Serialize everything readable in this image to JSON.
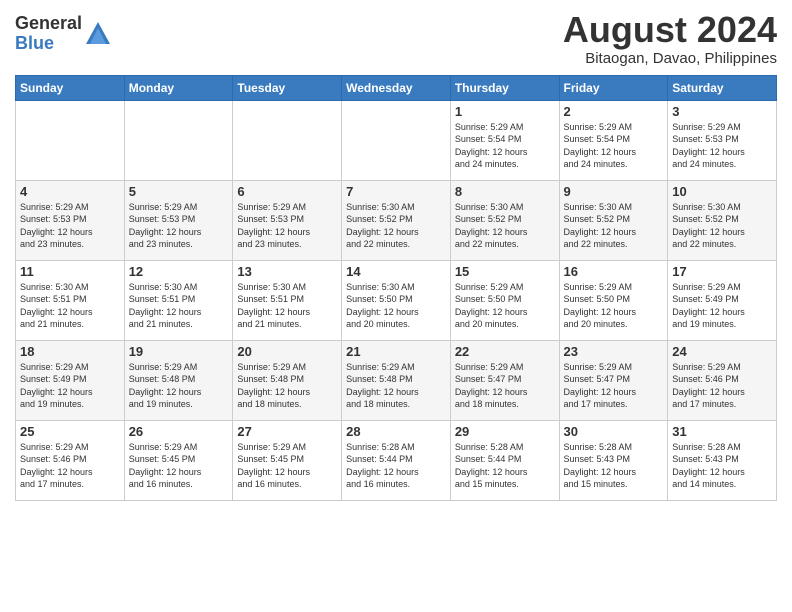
{
  "logo": {
    "general": "General",
    "blue": "Blue"
  },
  "title": {
    "month_year": "August 2024",
    "location": "Bitaogan, Davao, Philippines"
  },
  "days_of_week": [
    "Sunday",
    "Monday",
    "Tuesday",
    "Wednesday",
    "Thursday",
    "Friday",
    "Saturday"
  ],
  "weeks": [
    [
      {
        "day": "",
        "info": ""
      },
      {
        "day": "",
        "info": ""
      },
      {
        "day": "",
        "info": ""
      },
      {
        "day": "",
        "info": ""
      },
      {
        "day": "1",
        "info": "Sunrise: 5:29 AM\nSunset: 5:54 PM\nDaylight: 12 hours\nand 24 minutes."
      },
      {
        "day": "2",
        "info": "Sunrise: 5:29 AM\nSunset: 5:54 PM\nDaylight: 12 hours\nand 24 minutes."
      },
      {
        "day": "3",
        "info": "Sunrise: 5:29 AM\nSunset: 5:53 PM\nDaylight: 12 hours\nand 24 minutes."
      }
    ],
    [
      {
        "day": "4",
        "info": "Sunrise: 5:29 AM\nSunset: 5:53 PM\nDaylight: 12 hours\nand 23 minutes."
      },
      {
        "day": "5",
        "info": "Sunrise: 5:29 AM\nSunset: 5:53 PM\nDaylight: 12 hours\nand 23 minutes."
      },
      {
        "day": "6",
        "info": "Sunrise: 5:29 AM\nSunset: 5:53 PM\nDaylight: 12 hours\nand 23 minutes."
      },
      {
        "day": "7",
        "info": "Sunrise: 5:30 AM\nSunset: 5:52 PM\nDaylight: 12 hours\nand 22 minutes."
      },
      {
        "day": "8",
        "info": "Sunrise: 5:30 AM\nSunset: 5:52 PM\nDaylight: 12 hours\nand 22 minutes."
      },
      {
        "day": "9",
        "info": "Sunrise: 5:30 AM\nSunset: 5:52 PM\nDaylight: 12 hours\nand 22 minutes."
      },
      {
        "day": "10",
        "info": "Sunrise: 5:30 AM\nSunset: 5:52 PM\nDaylight: 12 hours\nand 22 minutes."
      }
    ],
    [
      {
        "day": "11",
        "info": "Sunrise: 5:30 AM\nSunset: 5:51 PM\nDaylight: 12 hours\nand 21 minutes."
      },
      {
        "day": "12",
        "info": "Sunrise: 5:30 AM\nSunset: 5:51 PM\nDaylight: 12 hours\nand 21 minutes."
      },
      {
        "day": "13",
        "info": "Sunrise: 5:30 AM\nSunset: 5:51 PM\nDaylight: 12 hours\nand 21 minutes."
      },
      {
        "day": "14",
        "info": "Sunrise: 5:30 AM\nSunset: 5:50 PM\nDaylight: 12 hours\nand 20 minutes."
      },
      {
        "day": "15",
        "info": "Sunrise: 5:29 AM\nSunset: 5:50 PM\nDaylight: 12 hours\nand 20 minutes."
      },
      {
        "day": "16",
        "info": "Sunrise: 5:29 AM\nSunset: 5:50 PM\nDaylight: 12 hours\nand 20 minutes."
      },
      {
        "day": "17",
        "info": "Sunrise: 5:29 AM\nSunset: 5:49 PM\nDaylight: 12 hours\nand 19 minutes."
      }
    ],
    [
      {
        "day": "18",
        "info": "Sunrise: 5:29 AM\nSunset: 5:49 PM\nDaylight: 12 hours\nand 19 minutes."
      },
      {
        "day": "19",
        "info": "Sunrise: 5:29 AM\nSunset: 5:48 PM\nDaylight: 12 hours\nand 19 minutes."
      },
      {
        "day": "20",
        "info": "Sunrise: 5:29 AM\nSunset: 5:48 PM\nDaylight: 12 hours\nand 18 minutes."
      },
      {
        "day": "21",
        "info": "Sunrise: 5:29 AM\nSunset: 5:48 PM\nDaylight: 12 hours\nand 18 minutes."
      },
      {
        "day": "22",
        "info": "Sunrise: 5:29 AM\nSunset: 5:47 PM\nDaylight: 12 hours\nand 18 minutes."
      },
      {
        "day": "23",
        "info": "Sunrise: 5:29 AM\nSunset: 5:47 PM\nDaylight: 12 hours\nand 17 minutes."
      },
      {
        "day": "24",
        "info": "Sunrise: 5:29 AM\nSunset: 5:46 PM\nDaylight: 12 hours\nand 17 minutes."
      }
    ],
    [
      {
        "day": "25",
        "info": "Sunrise: 5:29 AM\nSunset: 5:46 PM\nDaylight: 12 hours\nand 17 minutes."
      },
      {
        "day": "26",
        "info": "Sunrise: 5:29 AM\nSunset: 5:45 PM\nDaylight: 12 hours\nand 16 minutes."
      },
      {
        "day": "27",
        "info": "Sunrise: 5:29 AM\nSunset: 5:45 PM\nDaylight: 12 hours\nand 16 minutes."
      },
      {
        "day": "28",
        "info": "Sunrise: 5:28 AM\nSunset: 5:44 PM\nDaylight: 12 hours\nand 16 minutes."
      },
      {
        "day": "29",
        "info": "Sunrise: 5:28 AM\nSunset: 5:44 PM\nDaylight: 12 hours\nand 15 minutes."
      },
      {
        "day": "30",
        "info": "Sunrise: 5:28 AM\nSunset: 5:43 PM\nDaylight: 12 hours\nand 15 minutes."
      },
      {
        "day": "31",
        "info": "Sunrise: 5:28 AM\nSunset: 5:43 PM\nDaylight: 12 hours\nand 14 minutes."
      }
    ]
  ]
}
